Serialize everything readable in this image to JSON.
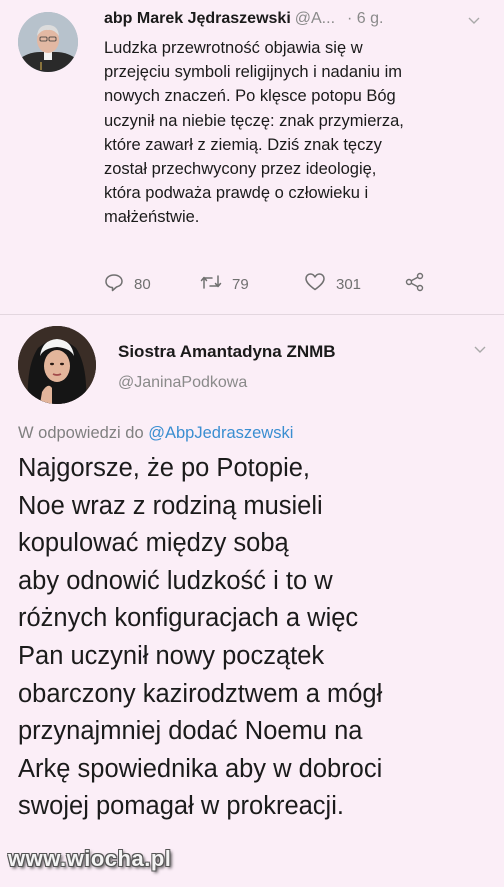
{
  "tweet1": {
    "author_name": "abp Marek Jędraszewski",
    "handle": "@A...",
    "time": "· 6 g.",
    "lines": [
      "Ludzka przewrotność objawia się w",
      "przejęciu symboli religijnych i nadaniu im",
      "nowych znaczeń. Po klęsce potopu Bóg",
      "uczynił na niebie tęczę: znak przymierza,",
      "które zawarł z ziemią. Dziś znak tęczy",
      "został przechwycony przez ideologię,",
      "która podważa prawdę o człowieku i",
      "małżeństwie."
    ],
    "replies": "80",
    "retweets": "79",
    "likes": "301"
  },
  "tweet2": {
    "author_name": "Siostra Amantadyna ZNMB",
    "handle": "@JaninaPodkowa",
    "reply_prefix": "W odpowiedzi do",
    "reply_to": "@AbpJedraszewski",
    "lines": [
      "Najgorsze, że po Potopie,",
      "Noe wraz z rodziną musieli",
      "kopulować między sobą",
      "aby odnowić ludzkość i to w",
      "różnych konfiguracjach a więc",
      "Pan uczynił nowy początek",
      "obarczony kazirodztwem a mógł",
      "przynajmniej dodać Noemu na",
      "Arkę spowiednika aby w dobroci",
      "swojej pomagał w prokreacji."
    ]
  },
  "watermark": "www.wiocha.pl",
  "icons": {
    "reply": "reply-icon",
    "retweet": "retweet-icon",
    "like": "heart-icon",
    "share": "share-icon",
    "more": "chevron-down-icon"
  },
  "colors": {
    "background": "#fbeef7",
    "mention": "#3a8ed1",
    "secondary_text": "#8a8a8a"
  }
}
